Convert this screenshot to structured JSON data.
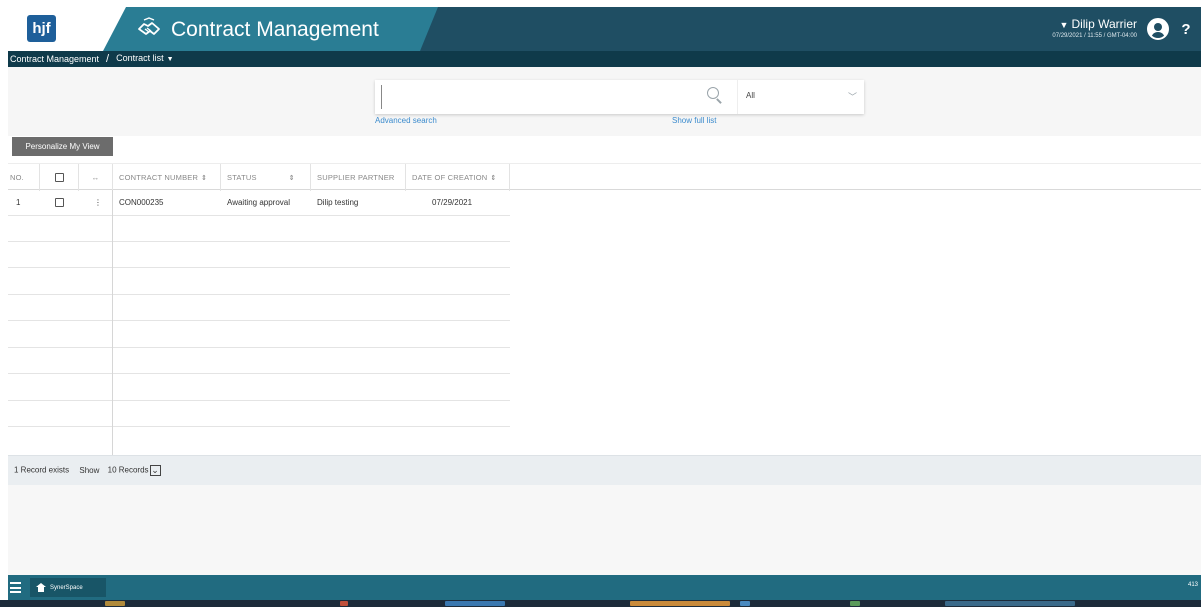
{
  "header": {
    "logo_text": "hjf",
    "app_title": "Contract Management",
    "user_name": "Dilip Warrier",
    "user_datetime": "07/29/2021 / 11:55 / GMT-04:00",
    "help_label": "?"
  },
  "breadcrumb": {
    "root": "Contract Management",
    "separator": "/",
    "current": "Contract list"
  },
  "search": {
    "input_value": "",
    "scope_value": "All",
    "advanced_link": "Advanced search",
    "full_list_link": "Show full list"
  },
  "toolbar": {
    "personalize_label": "Personalize My View"
  },
  "table": {
    "columns": {
      "no": "NO.",
      "contract_number": "CONTRACT NUMBER",
      "status": "STATUS",
      "supplier_partner": "SUPPLIER PARTNER",
      "date_of_creation": "DATE OF CREATION"
    },
    "sort_symbol": "⇕",
    "resize_symbol": "↔",
    "row_menu_symbol": "⋮",
    "rows": [
      {
        "no": "1",
        "contract_number": "CON000235",
        "status": "Awaiting approval",
        "supplier_partner": "Dilip testing",
        "date_of_creation": "07/29/2021"
      }
    ]
  },
  "footer": {
    "records_text": "1 Record exists",
    "show_label": "Show",
    "records_per_page": "10 Records"
  },
  "bottom_bar": {
    "space_label": "SynerSpace",
    "right_text": "413"
  },
  "colors": {
    "header_dark": "#1f4e63",
    "header_band": "#2a7d94",
    "breadcrumb_bg": "#0f3a4a",
    "link": "#3b8bcd",
    "bottom_bar": "#216b80"
  }
}
